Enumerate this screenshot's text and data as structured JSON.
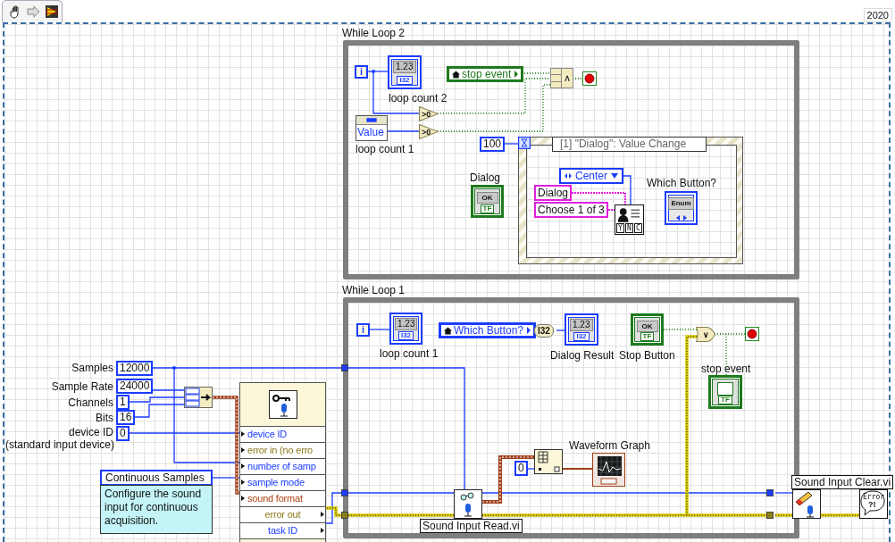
{
  "toolbar": {
    "version": "2020"
  },
  "while_loop_2": {
    "title": "While Loop 2",
    "iteration": "i",
    "loop_count_2": {
      "label": "loop count 2",
      "value": "1.23",
      "type": "I32"
    },
    "property_node": {
      "property": "Value",
      "label": "loop count 1"
    },
    "comparisons": [
      ">0",
      ">0"
    ],
    "stop_event_variable": "stop event",
    "compound_and": "∧",
    "timeout": "100",
    "event_case": "[1] \"Dialog\": Value Change",
    "dialog_button": {
      "label": "Dialog",
      "button_text": "OK",
      "type": "TF"
    },
    "justification": "Center",
    "message": "Dialog",
    "button_names": "Choose 1 of 3",
    "dialog_keys": [
      "Y",
      "N",
      "C"
    ],
    "which_button": {
      "label": "Which Button?",
      "value": "Enum"
    }
  },
  "while_loop_1": {
    "title": "While Loop 1",
    "iteration": "i",
    "loop_count_1": {
      "label": "loop count 1",
      "value": "1.23",
      "type": "I32"
    },
    "which_button_variable": "Which Button?",
    "conversion": "I32",
    "dialog_result": {
      "label": "Dialog Result",
      "value": "1.23",
      "type": "I32"
    },
    "stop_button": {
      "label": "Stop Button",
      "button_text": "OK",
      "type": "TF"
    },
    "compound_or": "∨",
    "stop_event": {
      "label": "stop event",
      "type": "TF"
    },
    "waveform_graph": {
      "label": "Waveform Graph"
    },
    "index": "0",
    "sound_input_read": "Sound Input Read.vi"
  },
  "inputs": [
    {
      "label": "Samples",
      "value": "12000"
    },
    {
      "label": "Sample Rate",
      "value": "24000"
    },
    {
      "label": "Channels",
      "value": "1"
    },
    {
      "label": "Bits",
      "value": "16"
    },
    {
      "label": "device ID",
      "value": "0"
    }
  ],
  "input_note": "(standard input device)",
  "sample_mode": "Continuous Samples",
  "comment": "Configure the sound input for continuous acquisition.",
  "configure_node": {
    "terminals": [
      {
        "name": "device ID",
        "kind": "numeric",
        "output": false
      },
      {
        "name": "error in (no erro",
        "kind": "error",
        "output": false
      },
      {
        "name": "number of samp",
        "kind": "numeric",
        "output": false
      },
      {
        "name": "sample mode",
        "kind": "numeric",
        "output": false
      },
      {
        "name": "sound format",
        "kind": "cluster",
        "output": false
      },
      {
        "name": "error out",
        "kind": "error",
        "output": true
      },
      {
        "name": "task ID",
        "kind": "numeric",
        "output": true
      }
    ]
  },
  "sound_input_clear": "Sound Input Clear.vi",
  "error_handler": {
    "text": "Error",
    "mark": "?!"
  }
}
